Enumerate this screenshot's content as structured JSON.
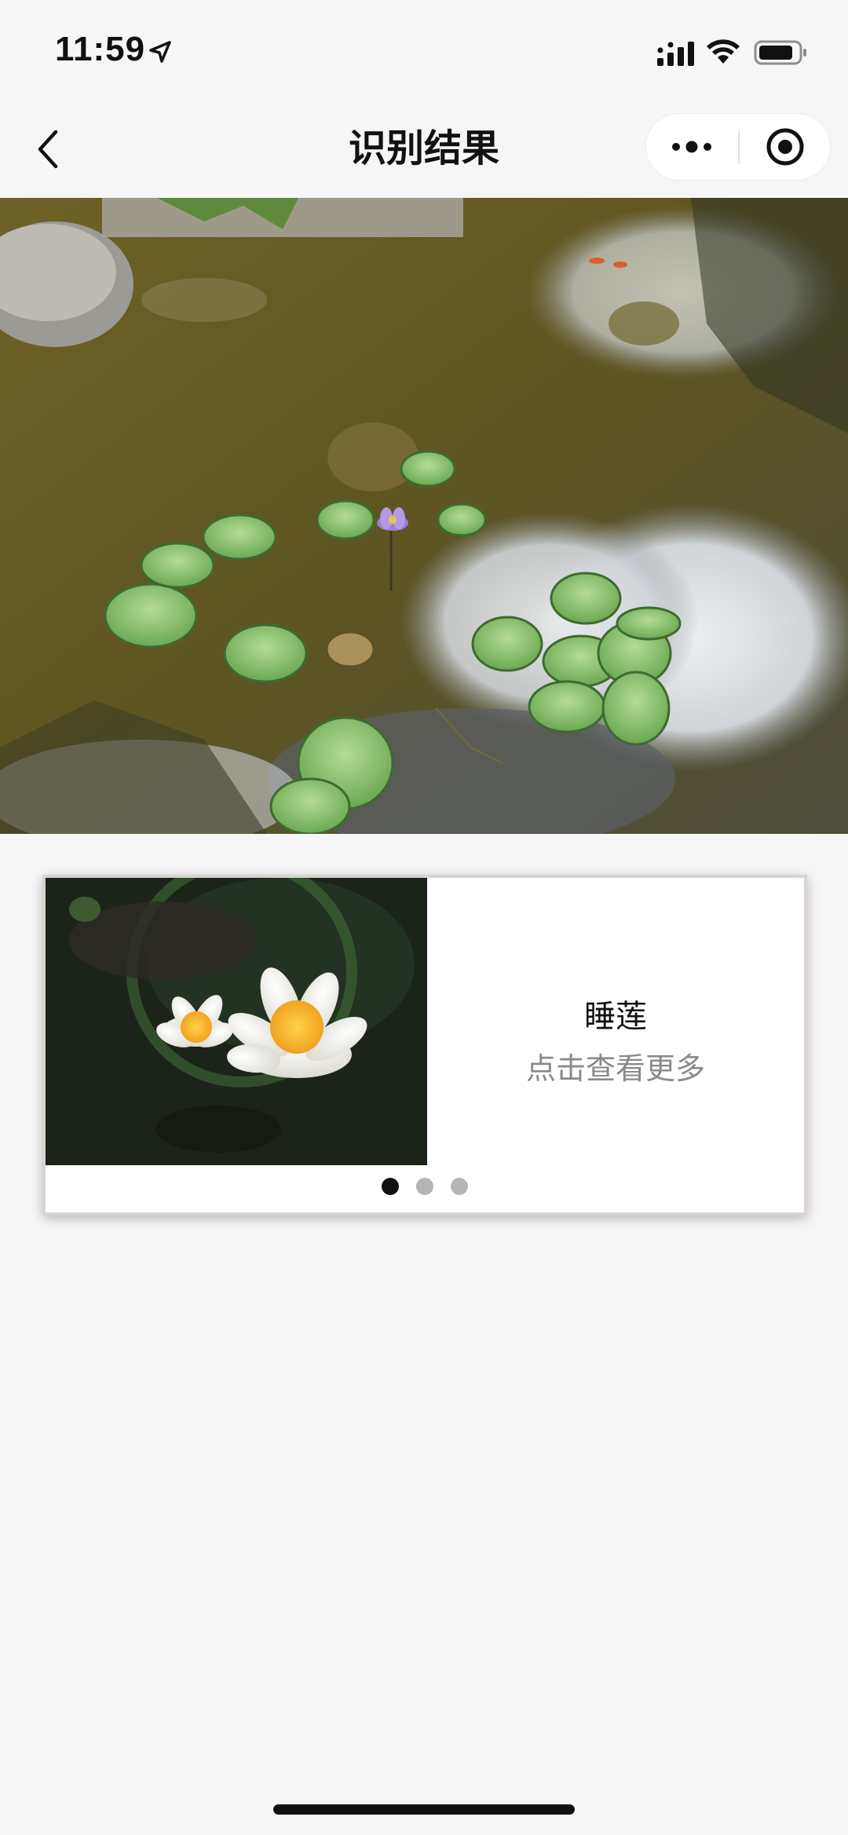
{
  "status_bar": {
    "time": "11:59",
    "icons": [
      "location-arrow-icon",
      "cellular-signal-icon",
      "wifi-icon",
      "battery-icon"
    ]
  },
  "nav": {
    "title": "识别结果",
    "back_icon": "chevron-left-icon",
    "more_icon": "more-dots-icon",
    "close_icon": "record-target-icon"
  },
  "photo": {
    "subject": "pond-with-water-lilies"
  },
  "result_card": {
    "name": "睡莲",
    "more_label": "点击查看更多",
    "carousel": {
      "total": 3,
      "active_index": 0
    }
  },
  "colors": {
    "background": "#f6f6f6",
    "card_background": "#ffffff",
    "title_text": "#111111",
    "secondary_text": "#8a8a8a",
    "dot_active": "#111111",
    "dot_inactive": "#b5b5b5"
  }
}
